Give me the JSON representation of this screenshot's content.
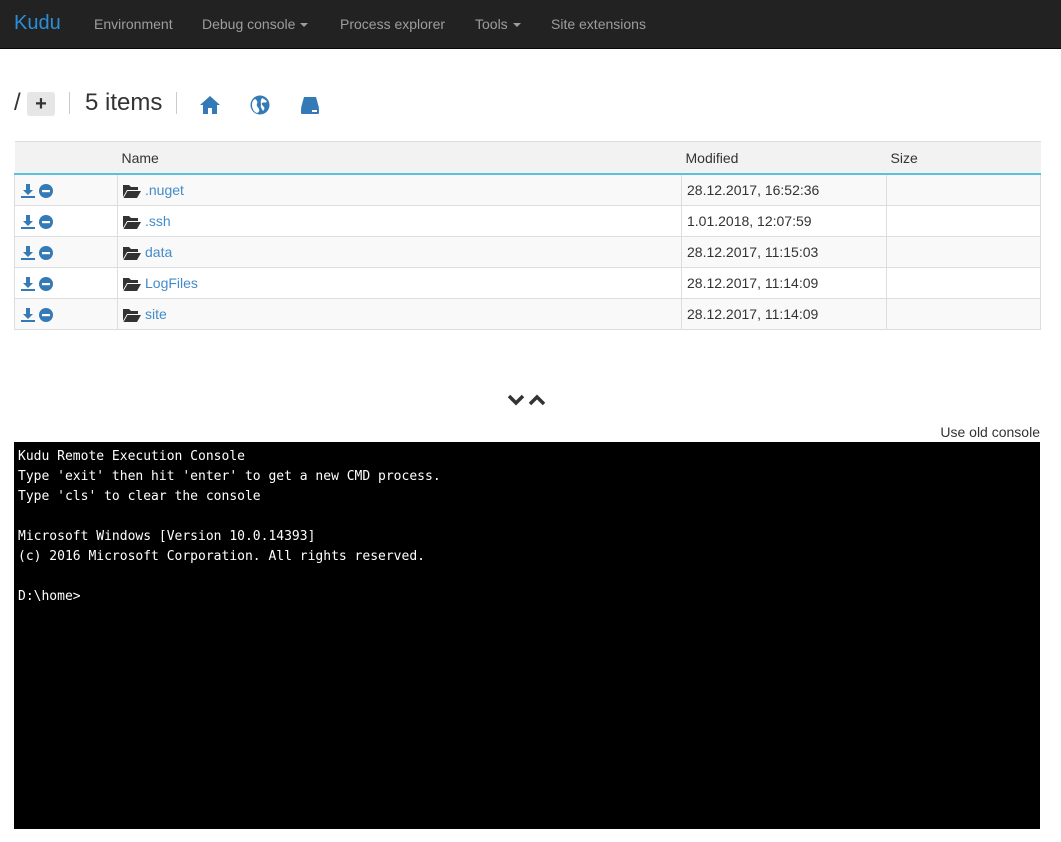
{
  "navbar": {
    "brand": "Kudu",
    "items": [
      {
        "label": "Environment",
        "has_caret": false
      },
      {
        "label": "Debug console",
        "has_caret": true
      },
      {
        "label": "Process explorer",
        "has_caret": false
      },
      {
        "label": "Tools",
        "has_caret": true
      },
      {
        "label": "Site extensions",
        "has_caret": false
      }
    ]
  },
  "pathbar": {
    "root": "/",
    "add_label": "+",
    "items_count": "5 items",
    "icons": [
      "home-icon",
      "globe-icon",
      "drive-icon"
    ]
  },
  "table": {
    "headers": {
      "name": "Name",
      "modified": "Modified",
      "size": "Size"
    },
    "rows": [
      {
        "name": ".nuget",
        "modified": "28.12.2017, 16:52:36",
        "size": ""
      },
      {
        "name": ".ssh",
        "modified": "1.01.2018, 12:07:59",
        "size": ""
      },
      {
        "name": "data",
        "modified": "28.12.2017, 11:15:03",
        "size": ""
      },
      {
        "name": "LogFiles",
        "modified": "28.12.2017, 11:14:09",
        "size": ""
      },
      {
        "name": "site",
        "modified": "28.12.2017, 11:14:09",
        "size": ""
      }
    ]
  },
  "console": {
    "old_console_label": "Use old console",
    "lines": [
      "Kudu Remote Execution Console",
      "Type 'exit' then hit 'enter' to get a new CMD process.",
      "Type 'cls' to clear the console",
      "",
      "Microsoft Windows [Version 10.0.14393]",
      "(c) 2016 Microsoft Corporation. All rights reserved.",
      "",
      "D:\\home>"
    ]
  },
  "colors": {
    "navbar_bg": "#222222",
    "link": "#428bca",
    "icon_blue": "#337ab7",
    "console_bg": "#000000"
  }
}
